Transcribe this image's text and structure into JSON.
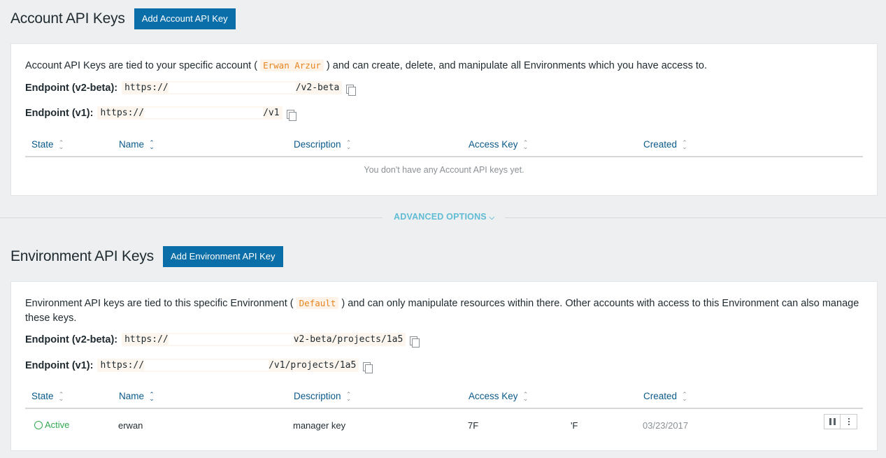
{
  "account": {
    "title": "Account API Keys",
    "add_button": "Add Account API Key",
    "desc_before": "Account API Keys are tied to your specific account (",
    "account_name": "Erwan Arzur",
    "desc_after": ") and can create, delete, and manipulate all Environments which you have access to.",
    "endpoint_v2_label": "Endpoint (v2-beta):",
    "endpoint_v2_start": "https://",
    "endpoint_v2_end": "/v2-beta",
    "endpoint_v1_label": "Endpoint (v1):",
    "endpoint_v1_start": "https://",
    "endpoint_v1_end": "/v1",
    "columns": [
      "State",
      "Name",
      "Description",
      "Access Key",
      "Created"
    ],
    "empty_message": "You don't have any Account API keys yet."
  },
  "advanced": {
    "label": "ADVANCED OPTIONS",
    "chevron": "chevron-down-icon"
  },
  "environment": {
    "title": "Environment API Keys",
    "add_button": "Add Environment API Key",
    "desc_before": "Environment API keys are tied to this specific Environment (",
    "env_name": "Default",
    "desc_after": ") and can only manipulate resources within there. Other accounts with access to this Environment can also manage these keys.",
    "endpoint_v2_label": "Endpoint (v2-beta):",
    "endpoint_v2_start": "https://",
    "endpoint_v2_end": "v2-beta/projects/1a5",
    "endpoint_v1_label": "Endpoint (v1):",
    "endpoint_v1_start": "https://",
    "endpoint_v1_end": "/v1/projects/1a5",
    "columns": [
      "State",
      "Name",
      "Description",
      "Access Key",
      "Created"
    ],
    "rows": [
      {
        "state": "Active",
        "name": "erwan",
        "description": "manager key",
        "access_key_start": "7F",
        "access_key_end": "'F",
        "created": "03/23/2017"
      }
    ]
  },
  "colors": {
    "primary_button": "#0a6ea8",
    "active_status": "#2fa84f",
    "advanced_link": "#60bcd4",
    "code_chip": "#e8841f"
  }
}
